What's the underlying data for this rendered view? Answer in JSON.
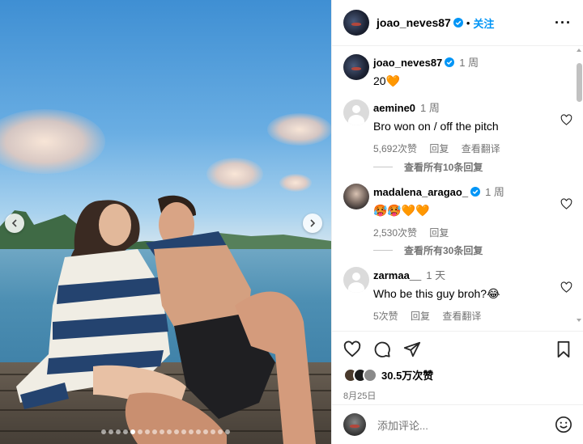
{
  "post": {
    "author": "joao_neves87",
    "follow_label": "关注",
    "separator": "•",
    "more_label": "···",
    "caption": "20🧡",
    "caption_time": "1 周"
  },
  "comments": [
    {
      "user": "aemine0",
      "time": "1 周",
      "text": "Bro won on / off the pitch",
      "likes": "5,692次赞",
      "reply": "回复",
      "translate": "查看翻译",
      "view_replies": "查看所有10条回复"
    },
    {
      "user": "madalena_aragao_",
      "verified": true,
      "time": "1 周",
      "text": "🥵🥵🧡🧡",
      "likes": "2,530次赞",
      "reply": "回复",
      "view_replies": "查看所有30条回复"
    },
    {
      "user": "zarmaa__",
      "time": "1 天",
      "text": "Who be this guy broh?😂",
      "likes": "5次赞",
      "reply": "回复",
      "translate": "查看翻译"
    }
  ],
  "footer": {
    "likes": "30.5万次赞",
    "date": "8月25日",
    "add_comment_placeholder": "添加评论..."
  },
  "carousel": {
    "total": 18,
    "active_index": 4
  },
  "colors": {
    "accent": "#0095f6",
    "muted": "#737373",
    "border": "#efefef"
  }
}
